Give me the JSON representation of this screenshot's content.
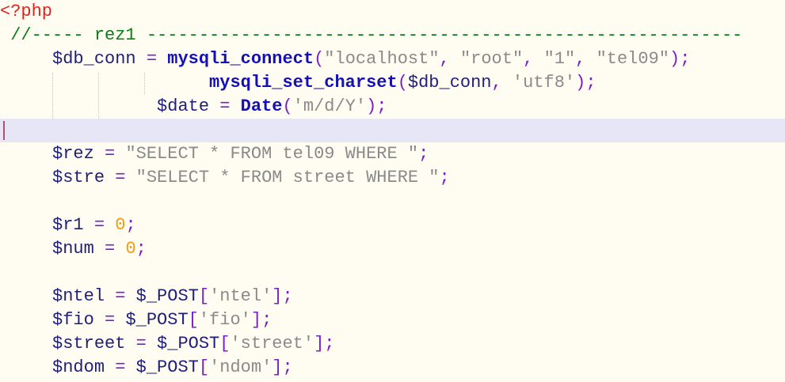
{
  "colors": {
    "background": "#fffdf2",
    "current_line": "#e6e6f7",
    "php_tag": "#e0231f",
    "comment": "#0b7d16",
    "variable": "#1f1f7a",
    "operator": "#7a1fc6",
    "function": "#1410b6",
    "string": "#8a8a8a",
    "number": "#f59a12"
  },
  "code": {
    "l1": {
      "t0": "<?php"
    },
    "l2": {
      "t0": "//----- rez1 ---------------------------------------------------------"
    },
    "l3": {
      "t0": "$db_conn",
      "t1": " = ",
      "t2": "mysqli_connect",
      "t3": "(",
      "t4": "\"localhost\"",
      "t5": ", ",
      "t6": "\"root\"",
      "t7": ", ",
      "t8": "\"1\"",
      "t9": ", ",
      "t10": "\"tel09\"",
      "t11": ");"
    },
    "l4": {
      "t0": "mysqli_set_charset",
      "t1": "(",
      "t2": "$db_conn",
      "t3": ", ",
      "t4": "'utf8'",
      "t5": ");"
    },
    "l5": {
      "t0": "$date",
      "t1": " = ",
      "t2": "Date",
      "t3": "(",
      "t4": "'m/d/Y'",
      "t5": ");"
    },
    "l6": {},
    "l7": {
      "t0": "$rez",
      "t1": " = ",
      "t2": "\"SELECT * FROM tel09 WHERE \"",
      "t3": ";"
    },
    "l8": {
      "t0": "$stre",
      "t1": " = ",
      "t2": "\"SELECT * FROM street WHERE \"",
      "t3": ";"
    },
    "l9": {},
    "l10": {
      "t0": "$r1",
      "t1": " = ",
      "t2": "0",
      "t3": ";"
    },
    "l11": {
      "t0": "$num",
      "t1": " = ",
      "t2": "0",
      "t3": ";"
    },
    "l12": {},
    "l13": {
      "t0": "$ntel",
      "t1": " = ",
      "t2": "$_POST",
      "t3": "[",
      "t4": "'ntel'",
      "t5": "];"
    },
    "l14": {
      "t0": "$fio",
      "t1": " = ",
      "t2": "$_POST",
      "t3": "[",
      "t4": "'fio'",
      "t5": "];"
    },
    "l15": {
      "t0": "$street",
      "t1": " = ",
      "t2": "$_POST",
      "t3": "[",
      "t4": "'street'",
      "t5": "];"
    },
    "l16": {
      "t0": "$ndom",
      "t1": " = ",
      "t2": "$_POST",
      "t3": "[",
      "t4": "'ndom'",
      "t5": "];"
    }
  }
}
